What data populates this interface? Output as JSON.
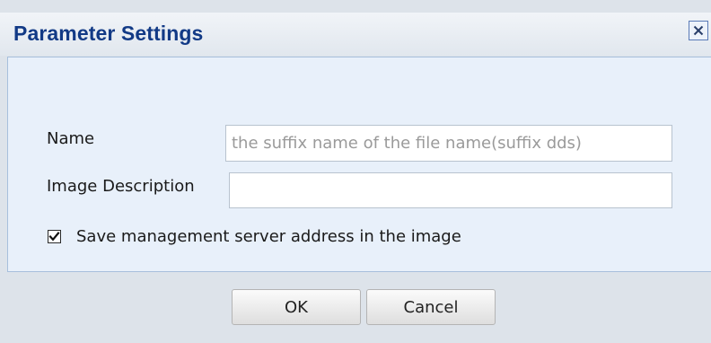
{
  "dialog": {
    "title": "Parameter Settings",
    "close_icon": "close-icon"
  },
  "form": {
    "name_label": "Name",
    "name_value": "",
    "name_placeholder": "the suffix name of the file name(suffix dds)",
    "description_label": "Image Description",
    "description_value": "",
    "save_address_label": "Save management server address in the image",
    "save_address_checked": true
  },
  "buttons": {
    "ok_label": "OK",
    "cancel_label": "Cancel"
  },
  "colors": {
    "title_text": "#123a86",
    "panel_background": "#e8f0fa",
    "panel_border": "#a7bfdc",
    "dialog_background": "#dde3ea"
  }
}
